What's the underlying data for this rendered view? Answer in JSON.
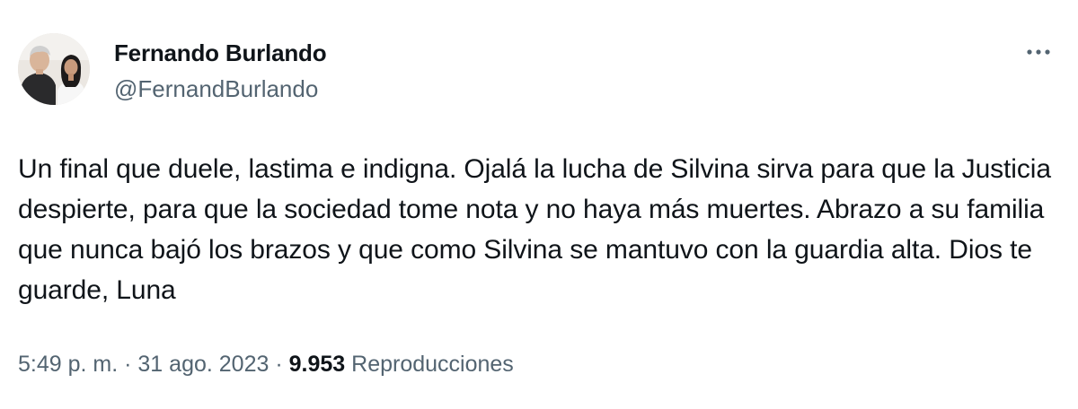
{
  "author": {
    "display_name": "Fernando Burlando",
    "handle": "@FernandBurlando",
    "avatar_icon": "profile-photo"
  },
  "menu": {
    "more_icon": "ellipsis-horizontal-icon"
  },
  "tweet": {
    "text": "Un final que duele, lastima e indigna. Ojalá la lucha de Silvina sirva para que la Justicia despierte, para que la sociedad tome nota y no haya más muertes. Abrazo a su familia que nunca bajó los brazos y que como Silvina se mantuvo con la guardia alta. Dios te guarde, Luna"
  },
  "meta": {
    "time": "5:49 p. m.",
    "separator": "·",
    "date": "31 ago. 2023",
    "views_count": "9.953",
    "views_label": "Reproducciones"
  },
  "colors": {
    "text_primary": "#0f1419",
    "text_secondary": "#536471",
    "background": "#ffffff"
  }
}
